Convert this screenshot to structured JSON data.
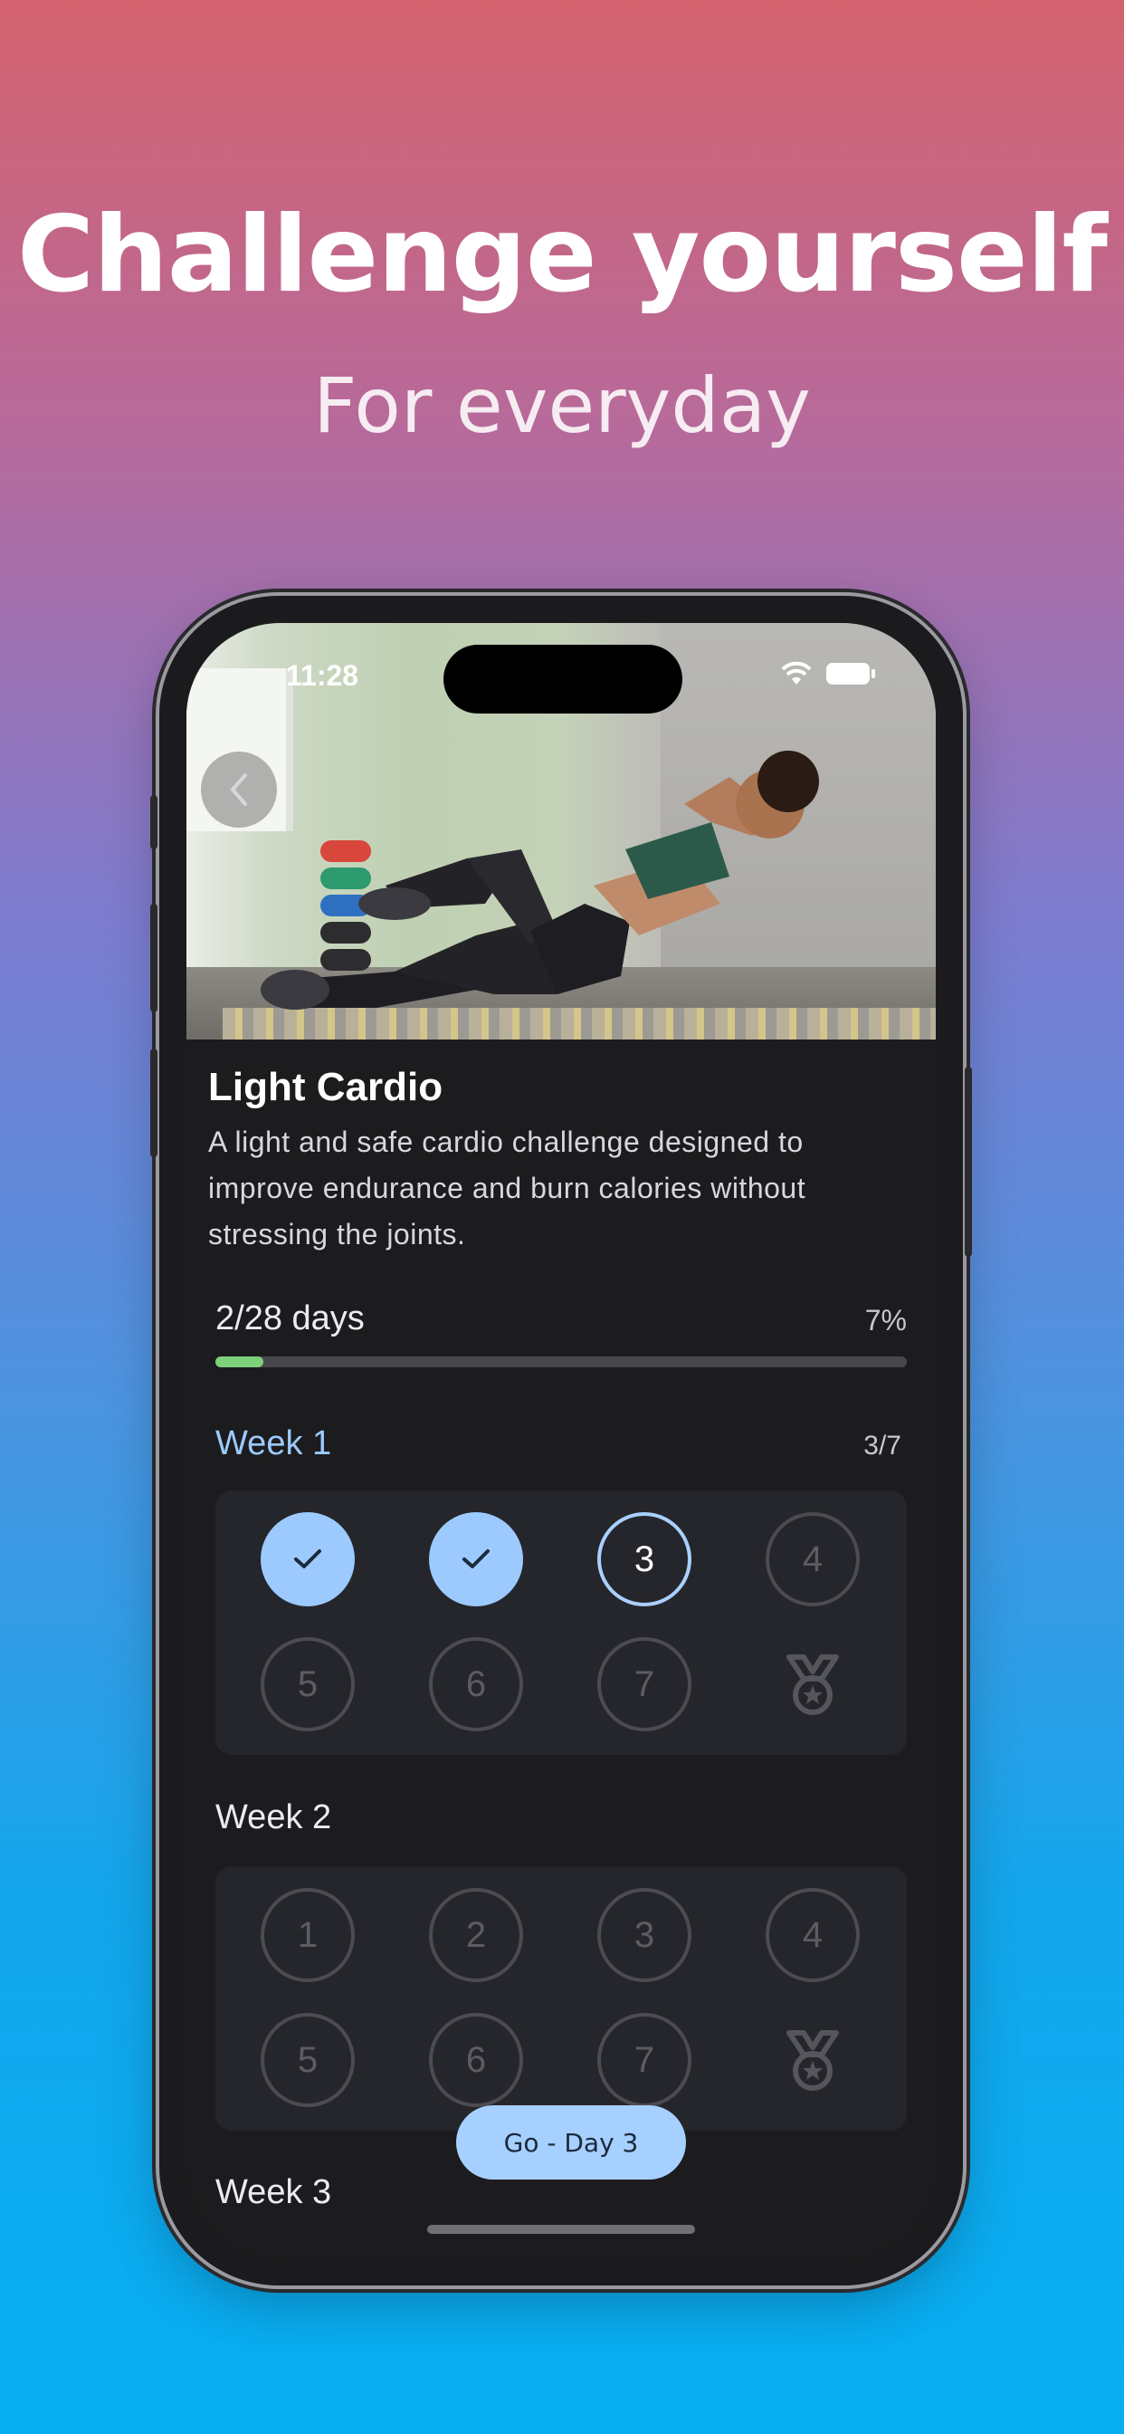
{
  "promo": {
    "headline": "Challenge yourself",
    "subline": "For everyday"
  },
  "status_bar": {
    "time": "11:28",
    "icons": [
      "wifi-icon",
      "battery-icon"
    ]
  },
  "hero": {
    "back_icon": "chevron-left-icon",
    "image_description_icon": "workout-photo"
  },
  "challenge": {
    "title": "Light Cardio",
    "description": "A light and safe cardio challenge designed to improve endurance and burn calories without stressing the joints.",
    "progress_label": "2/28 days",
    "progress_percent_label": "7%",
    "progress_fraction": 0.07
  },
  "weeks": [
    {
      "label": "Week 1",
      "count": "3/7",
      "days": [
        {
          "label": "",
          "state": "done"
        },
        {
          "label": "",
          "state": "done"
        },
        {
          "label": "3",
          "state": "current"
        },
        {
          "label": "4",
          "state": "future"
        },
        {
          "label": "5",
          "state": "future"
        },
        {
          "label": "6",
          "state": "future"
        },
        {
          "label": "7",
          "state": "future"
        }
      ]
    },
    {
      "label": "Week 2",
      "count": "",
      "days": [
        {
          "label": "1",
          "state": "future"
        },
        {
          "label": "2",
          "state": "future"
        },
        {
          "label": "3",
          "state": "future"
        },
        {
          "label": "4",
          "state": "future"
        },
        {
          "label": "5",
          "state": "future"
        },
        {
          "label": "6",
          "state": "future"
        },
        {
          "label": "7",
          "state": "future"
        }
      ]
    },
    {
      "label": "Week 3"
    }
  ],
  "go_button": "Go - Day 3",
  "colors": {
    "accent": "#9ccaff",
    "progress": "#7fd07a",
    "background": "#1c1c1e",
    "card": "#25262b"
  }
}
